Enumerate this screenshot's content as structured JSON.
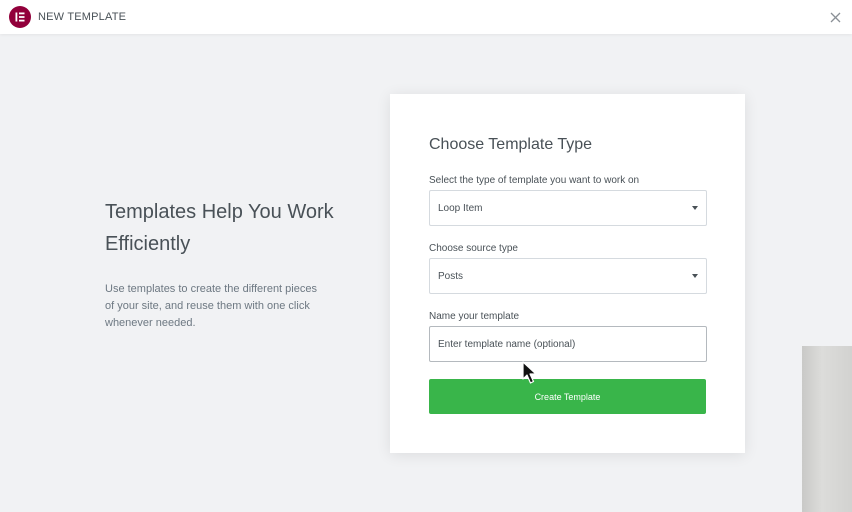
{
  "app": {
    "title": "NEW TEMPLATE",
    "logo_icon": "elementor-logo-icon",
    "close_icon": "close-icon",
    "brand_color": "#92003b"
  },
  "intro": {
    "heading": "Templates Help You Work Efficiently",
    "text": "Use templates to create the different pieces of your site, and reuse them with one click whenever needed."
  },
  "form": {
    "title": "Choose Template Type",
    "type_label": "Select the type of template you want to work on",
    "type_value": "Loop Item",
    "source_label": "Choose source type",
    "source_value": "Posts",
    "name_label": "Name your template",
    "name_placeholder": "Enter template name (optional)",
    "name_value": "",
    "submit_label": "Create Template",
    "submit_color": "#39b54a"
  }
}
